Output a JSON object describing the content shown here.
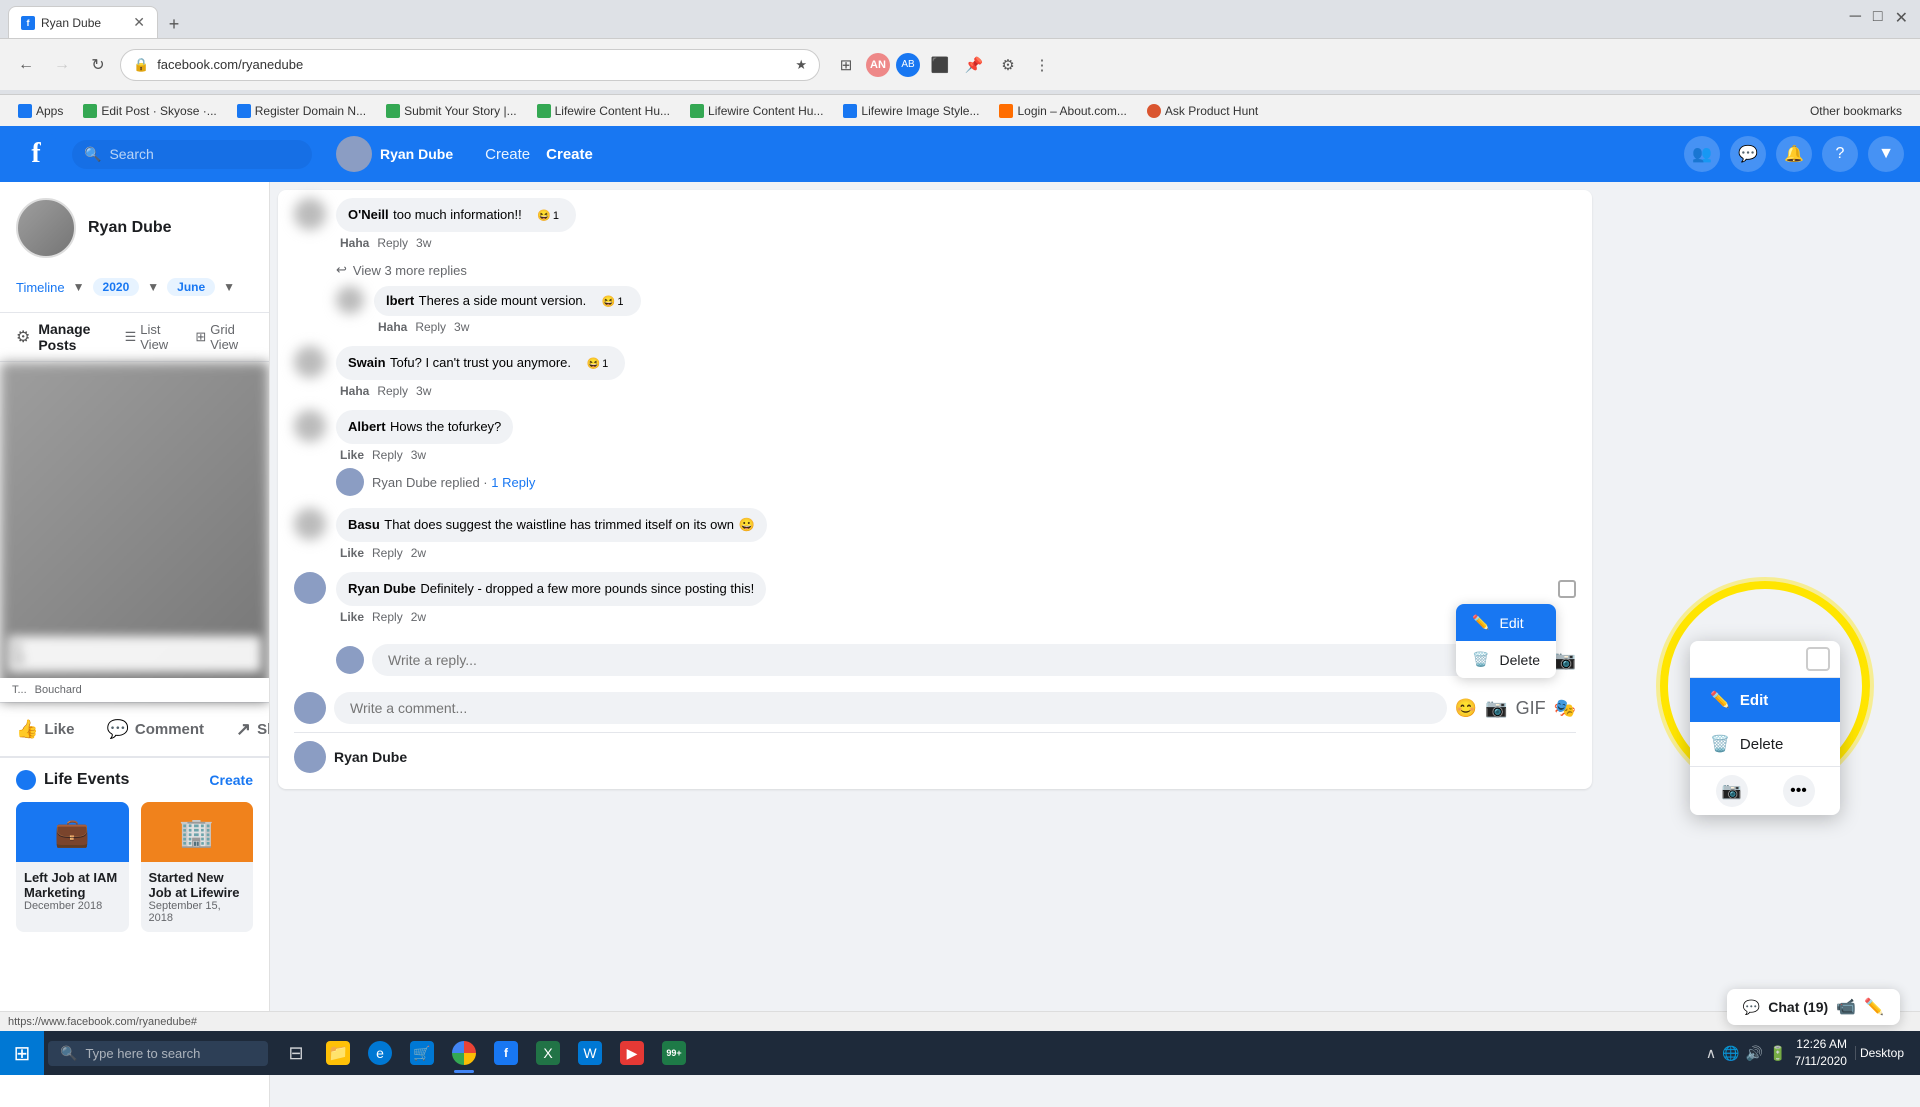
{
  "browser": {
    "tab_title": "Ryan Dube",
    "tab_favicon": "f",
    "url": "facebook.com/ryanedube",
    "bookmarks": [
      {
        "label": "Apps",
        "icon": "blue"
      },
      {
        "label": "Edit Post · Skyose ·...",
        "icon": "green"
      },
      {
        "label": "Register Domain N...",
        "icon": "blue"
      },
      {
        "label": "Submit Your Story |...",
        "icon": "green"
      },
      {
        "label": "Lifewire Content Hu...",
        "icon": "green"
      },
      {
        "label": "Lifewire Content Hu...",
        "icon": "green"
      },
      {
        "label": "Lifewire Image Style...",
        "icon": "blue"
      },
      {
        "label": "Login – About.com...",
        "icon": "orange"
      },
      {
        "label": "Ask Product Hunt",
        "icon": "ph"
      }
    ],
    "other_bookmarks": "Other bookmarks"
  },
  "facebook": {
    "logo": "f",
    "search_placeholder": "Search",
    "user": {
      "name": "Ryan Dube",
      "avatar_color": "#bbb"
    },
    "nav_items": [
      "Create"
    ]
  },
  "profile": {
    "name": "Ryan Dube",
    "nav_timeline": "Timeline",
    "year": "2020",
    "month": "June",
    "manage_posts_label": "Manage Posts",
    "list_view_label": "List View",
    "grid_view_label": "Grid View"
  },
  "post_actions": {
    "like": "Like",
    "comment": "Comment",
    "share": "Share"
  },
  "comments": [
    {
      "author": "O'Neill",
      "text": "too much information!!",
      "reaction": "Haha",
      "time": "3w",
      "reaction_count": "1",
      "reaction_emoji": "😆"
    },
    {
      "view_replies": "View 3 more replies",
      "sub_author": "lbert",
      "sub_text": "Theres a side mount version.",
      "sub_reaction": "Haha",
      "sub_time": "3w",
      "sub_reaction_count": "1"
    },
    {
      "author": "Swain",
      "text": "Tofu? I can't trust you anymore.",
      "reaction": "Haha",
      "time": "3w",
      "reaction_count": "1",
      "reaction_emoji": "😆"
    },
    {
      "author": "Albert",
      "text": "Hows the tofurkey?",
      "reaction": "Like",
      "time": "3w"
    }
  ],
  "ryan_dube_reply": {
    "text": "Ryan Dube replied",
    "replies_count": "1 Reply"
  },
  "basu_comment": {
    "author": "Basu",
    "text": "That does suggest the waistline has trimmed itself on its own",
    "emoji": "😀",
    "reaction": "Like",
    "time": "2w"
  },
  "ryan_final_comment": {
    "author": "Ryan Dube",
    "text": "Definitely - dropped a few more pounds since posting this!",
    "reaction": "Like",
    "time": "2w"
  },
  "context_menu": {
    "edit_label": "Edit",
    "delete_label": "Delete"
  },
  "write_reply_placeholder": "Write a reply...",
  "write_comment_placeholder": "Write a comment...",
  "life_events": {
    "title": "Life Events",
    "create_label": "Create",
    "events": [
      {
        "title": "Left Job at IAM Marketing",
        "date": "December 2018",
        "icon_bg": "blue"
      },
      {
        "title": "Started New Job at Lifewire",
        "date": "September 15, 2018",
        "icon_bg": "orange"
      }
    ]
  },
  "chat": {
    "label": "Chat (19)"
  },
  "taskbar": {
    "search_placeholder": "Type here to search",
    "time": "12:26 AM",
    "date": "7/11/2020",
    "desktop_label": "Desktop"
  },
  "status_bar": {
    "url_preview": "https://www.facebook.com/ryanedube#"
  }
}
